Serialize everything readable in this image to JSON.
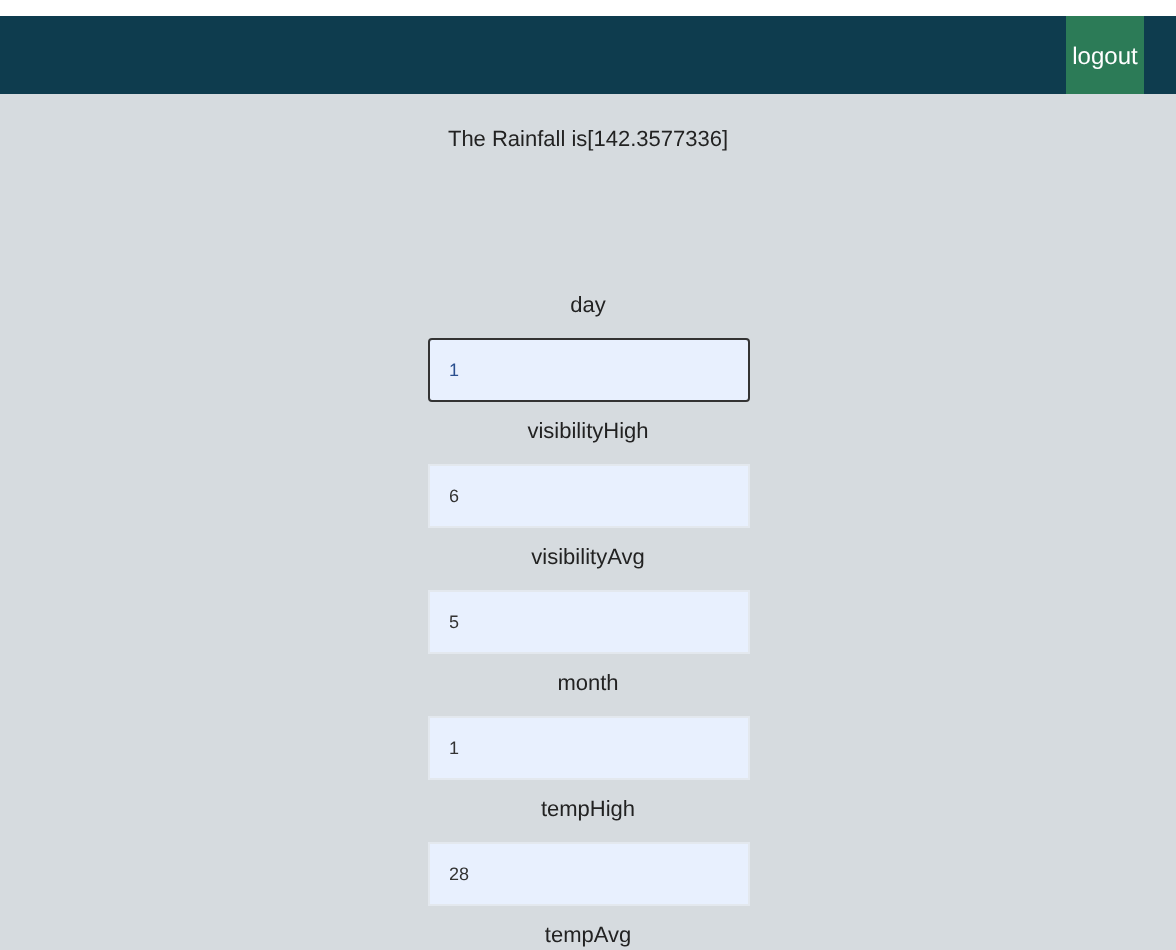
{
  "navbar": {
    "logout_button": "logout"
  },
  "result": "The Rainfall is[142.3577336]",
  "fields": [
    {
      "label": "day",
      "value": "1",
      "focused": true
    },
    {
      "label": "visibilityHigh",
      "value": "6",
      "focused": false
    },
    {
      "label": "visibilityAvg",
      "value": "5",
      "focused": false
    },
    {
      "label": "month",
      "value": "1",
      "focused": false
    },
    {
      "label": "tempHigh",
      "value": "28",
      "focused": false
    },
    {
      "label": "tempAvg"
    }
  ]
}
